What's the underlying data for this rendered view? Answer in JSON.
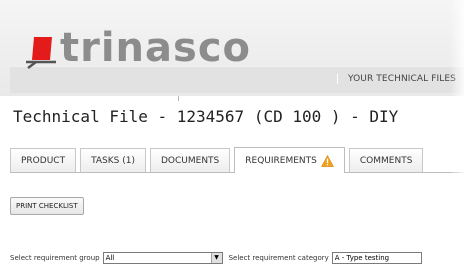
{
  "header": {
    "logo_text": "trinasco",
    "nav": [
      "YOUR TECHNICAL FILES"
    ]
  },
  "page": {
    "title": "Technical File - 1234567 (CD 100 ) - DIY"
  },
  "tabs": [
    {
      "label": "PRODUCT"
    },
    {
      "label": "TASKS (1)"
    },
    {
      "label": "DOCUMENTS"
    },
    {
      "label": "REQUIREMENTS",
      "icon": "warning-icon",
      "active": true
    },
    {
      "label": "COMMENTS"
    }
  ],
  "actions": {
    "print_label": "PRINT CHECKLIST"
  },
  "filters": {
    "group_label": "Select requirement group",
    "group_value": "All",
    "category_label": "Select requirement category",
    "category_value": "A - Type testing"
  },
  "colors": {
    "brand_red": "#e31b1b",
    "logo_gray": "#8c8c8c",
    "warning": "#f0a020"
  }
}
